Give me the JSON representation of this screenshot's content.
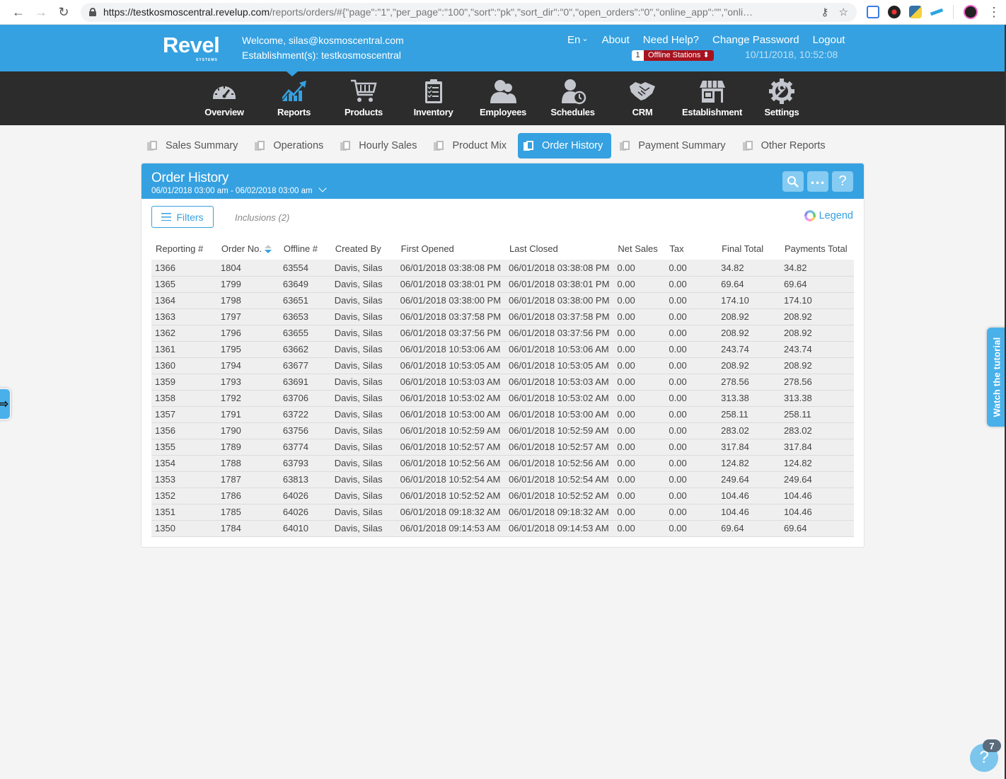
{
  "browser": {
    "url_host": "https://testkosmoscentral.revelup.com",
    "url_path": "/reports/orders/#{\"page\":\"1\",\"per_page\":\"100\",\"sort\":\"pk\",\"sort_dir\":\"0\",\"open_orders\":\"0\",\"online_app\":\"\",\"onli…",
    "icons": [
      "back-arrow-icon",
      "forward-arrow-icon",
      "reload-icon",
      "lock-icon",
      "key-icon",
      "star-icon",
      "menu-dots-icon"
    ]
  },
  "header": {
    "logo": "Revel",
    "logo_sub": "SYSTEMS",
    "welcome": "Welcome, silas@kosmoscentral.com",
    "establishment": "Establishment(s): testkosmoscentral",
    "language": "En",
    "links": [
      "About",
      "Need Help?",
      "Change Password",
      "Logout"
    ],
    "offline_count": "1",
    "offline_label": "Offline Stations ⬍",
    "timestamp": "10/11/2018, 10:52:08",
    "accent_color": "#35a1e0"
  },
  "mainnav": {
    "active": "Reports",
    "items": [
      {
        "label": "Overview",
        "icon": "speedometer-icon"
      },
      {
        "label": "Reports",
        "icon": "chart-trend-icon"
      },
      {
        "label": "Products",
        "icon": "shopping-cart-icon"
      },
      {
        "label": "Inventory",
        "icon": "clipboard-checklist-icon"
      },
      {
        "label": "Employees",
        "icon": "users-icon"
      },
      {
        "label": "Schedules",
        "icon": "user-clock-icon"
      },
      {
        "label": "CRM",
        "icon": "handshake-icon"
      },
      {
        "label": "Establishment",
        "icon": "storefront-icon"
      },
      {
        "label": "Settings",
        "icon": "gear-wrench-icon"
      }
    ]
  },
  "report_tabs": {
    "active": "Order History",
    "items": [
      "Sales Summary",
      "Operations",
      "Hourly Sales",
      "Product Mix",
      "Order History",
      "Payment Summary",
      "Other Reports"
    ]
  },
  "report": {
    "title": "Order History",
    "date_range": "06/01/2018 03:00 am - 06/02/2018 03:00 am",
    "filters_label": "Filters",
    "inclusions_label": "Inclusions (2)",
    "legend_label": "Legend",
    "columns": [
      "Reporting #",
      "Order No.",
      "Offline #",
      "Created By",
      "First Opened",
      "Last Closed",
      "Net Sales",
      "Tax",
      "Final Total",
      "Payments Total"
    ],
    "sorted_column": "Order No.",
    "rows": [
      [
        "1366",
        "1804",
        "63554",
        "Davis, Silas",
        "06/01/2018 03:38:08 PM",
        "06/01/2018 03:38:08 PM",
        "0.00",
        "0.00",
        "34.82",
        "34.82"
      ],
      [
        "1365",
        "1799",
        "63649",
        "Davis, Silas",
        "06/01/2018 03:38:01 PM",
        "06/01/2018 03:38:01 PM",
        "0.00",
        "0.00",
        "69.64",
        "69.64"
      ],
      [
        "1364",
        "1798",
        "63651",
        "Davis, Silas",
        "06/01/2018 03:38:00 PM",
        "06/01/2018 03:38:00 PM",
        "0.00",
        "0.00",
        "174.10",
        "174.10"
      ],
      [
        "1363",
        "1797",
        "63653",
        "Davis, Silas",
        "06/01/2018 03:37:58 PM",
        "06/01/2018 03:37:58 PM",
        "0.00",
        "0.00",
        "208.92",
        "208.92"
      ],
      [
        "1362",
        "1796",
        "63655",
        "Davis, Silas",
        "06/01/2018 03:37:56 PM",
        "06/01/2018 03:37:56 PM",
        "0.00",
        "0.00",
        "208.92",
        "208.92"
      ],
      [
        "1361",
        "1795",
        "63662",
        "Davis, Silas",
        "06/01/2018 10:53:06 AM",
        "06/01/2018 10:53:06 AM",
        "0.00",
        "0.00",
        "243.74",
        "243.74"
      ],
      [
        "1360",
        "1794",
        "63677",
        "Davis, Silas",
        "06/01/2018 10:53:05 AM",
        "06/01/2018 10:53:05 AM",
        "0.00",
        "0.00",
        "208.92",
        "208.92"
      ],
      [
        "1359",
        "1793",
        "63691",
        "Davis, Silas",
        "06/01/2018 10:53:03 AM",
        "06/01/2018 10:53:03 AM",
        "0.00",
        "0.00",
        "278.56",
        "278.56"
      ],
      [
        "1358",
        "1792",
        "63706",
        "Davis, Silas",
        "06/01/2018 10:53:02 AM",
        "06/01/2018 10:53:02 AM",
        "0.00",
        "0.00",
        "313.38",
        "313.38"
      ],
      [
        "1357",
        "1791",
        "63722",
        "Davis, Silas",
        "06/01/2018 10:53:00 AM",
        "06/01/2018 10:53:00 AM",
        "0.00",
        "0.00",
        "258.11",
        "258.11"
      ],
      [
        "1356",
        "1790",
        "63756",
        "Davis, Silas",
        "06/01/2018 10:52:59 AM",
        "06/01/2018 10:52:59 AM",
        "0.00",
        "0.00",
        "283.02",
        "283.02"
      ],
      [
        "1355",
        "1789",
        "63774",
        "Davis, Silas",
        "06/01/2018 10:52:57 AM",
        "06/01/2018 10:52:57 AM",
        "0.00",
        "0.00",
        "317.84",
        "317.84"
      ],
      [
        "1354",
        "1788",
        "63793",
        "Davis, Silas",
        "06/01/2018 10:52:56 AM",
        "06/01/2018 10:52:56 AM",
        "0.00",
        "0.00",
        "124.82",
        "124.82"
      ],
      [
        "1353",
        "1787",
        "63813",
        "Davis, Silas",
        "06/01/2018 10:52:54 AM",
        "06/01/2018 10:52:54 AM",
        "0.00",
        "0.00",
        "249.64",
        "249.64"
      ],
      [
        "1352",
        "1786",
        "64026",
        "Davis, Silas",
        "06/01/2018 10:52:52 AM",
        "06/01/2018 10:52:52 AM",
        "0.00",
        "0.00",
        "104.46",
        "104.46"
      ],
      [
        "1351",
        "1785",
        "64026",
        "Davis, Silas",
        "06/01/2018 09:18:32 AM",
        "06/01/2018 09:18:32 AM",
        "0.00",
        "0.00",
        "104.46",
        "104.46"
      ],
      [
        "1350",
        "1784",
        "64010",
        "Davis, Silas",
        "06/01/2018 09:14:53 AM",
        "06/01/2018 09:14:53 AM",
        "0.00",
        "0.00",
        "69.64",
        "69.64"
      ]
    ]
  },
  "widgets": {
    "tutorial_label": "Watch the tutorial",
    "side_toggle_icon": "⇨",
    "help_icon": "?",
    "help_badge": "7"
  }
}
